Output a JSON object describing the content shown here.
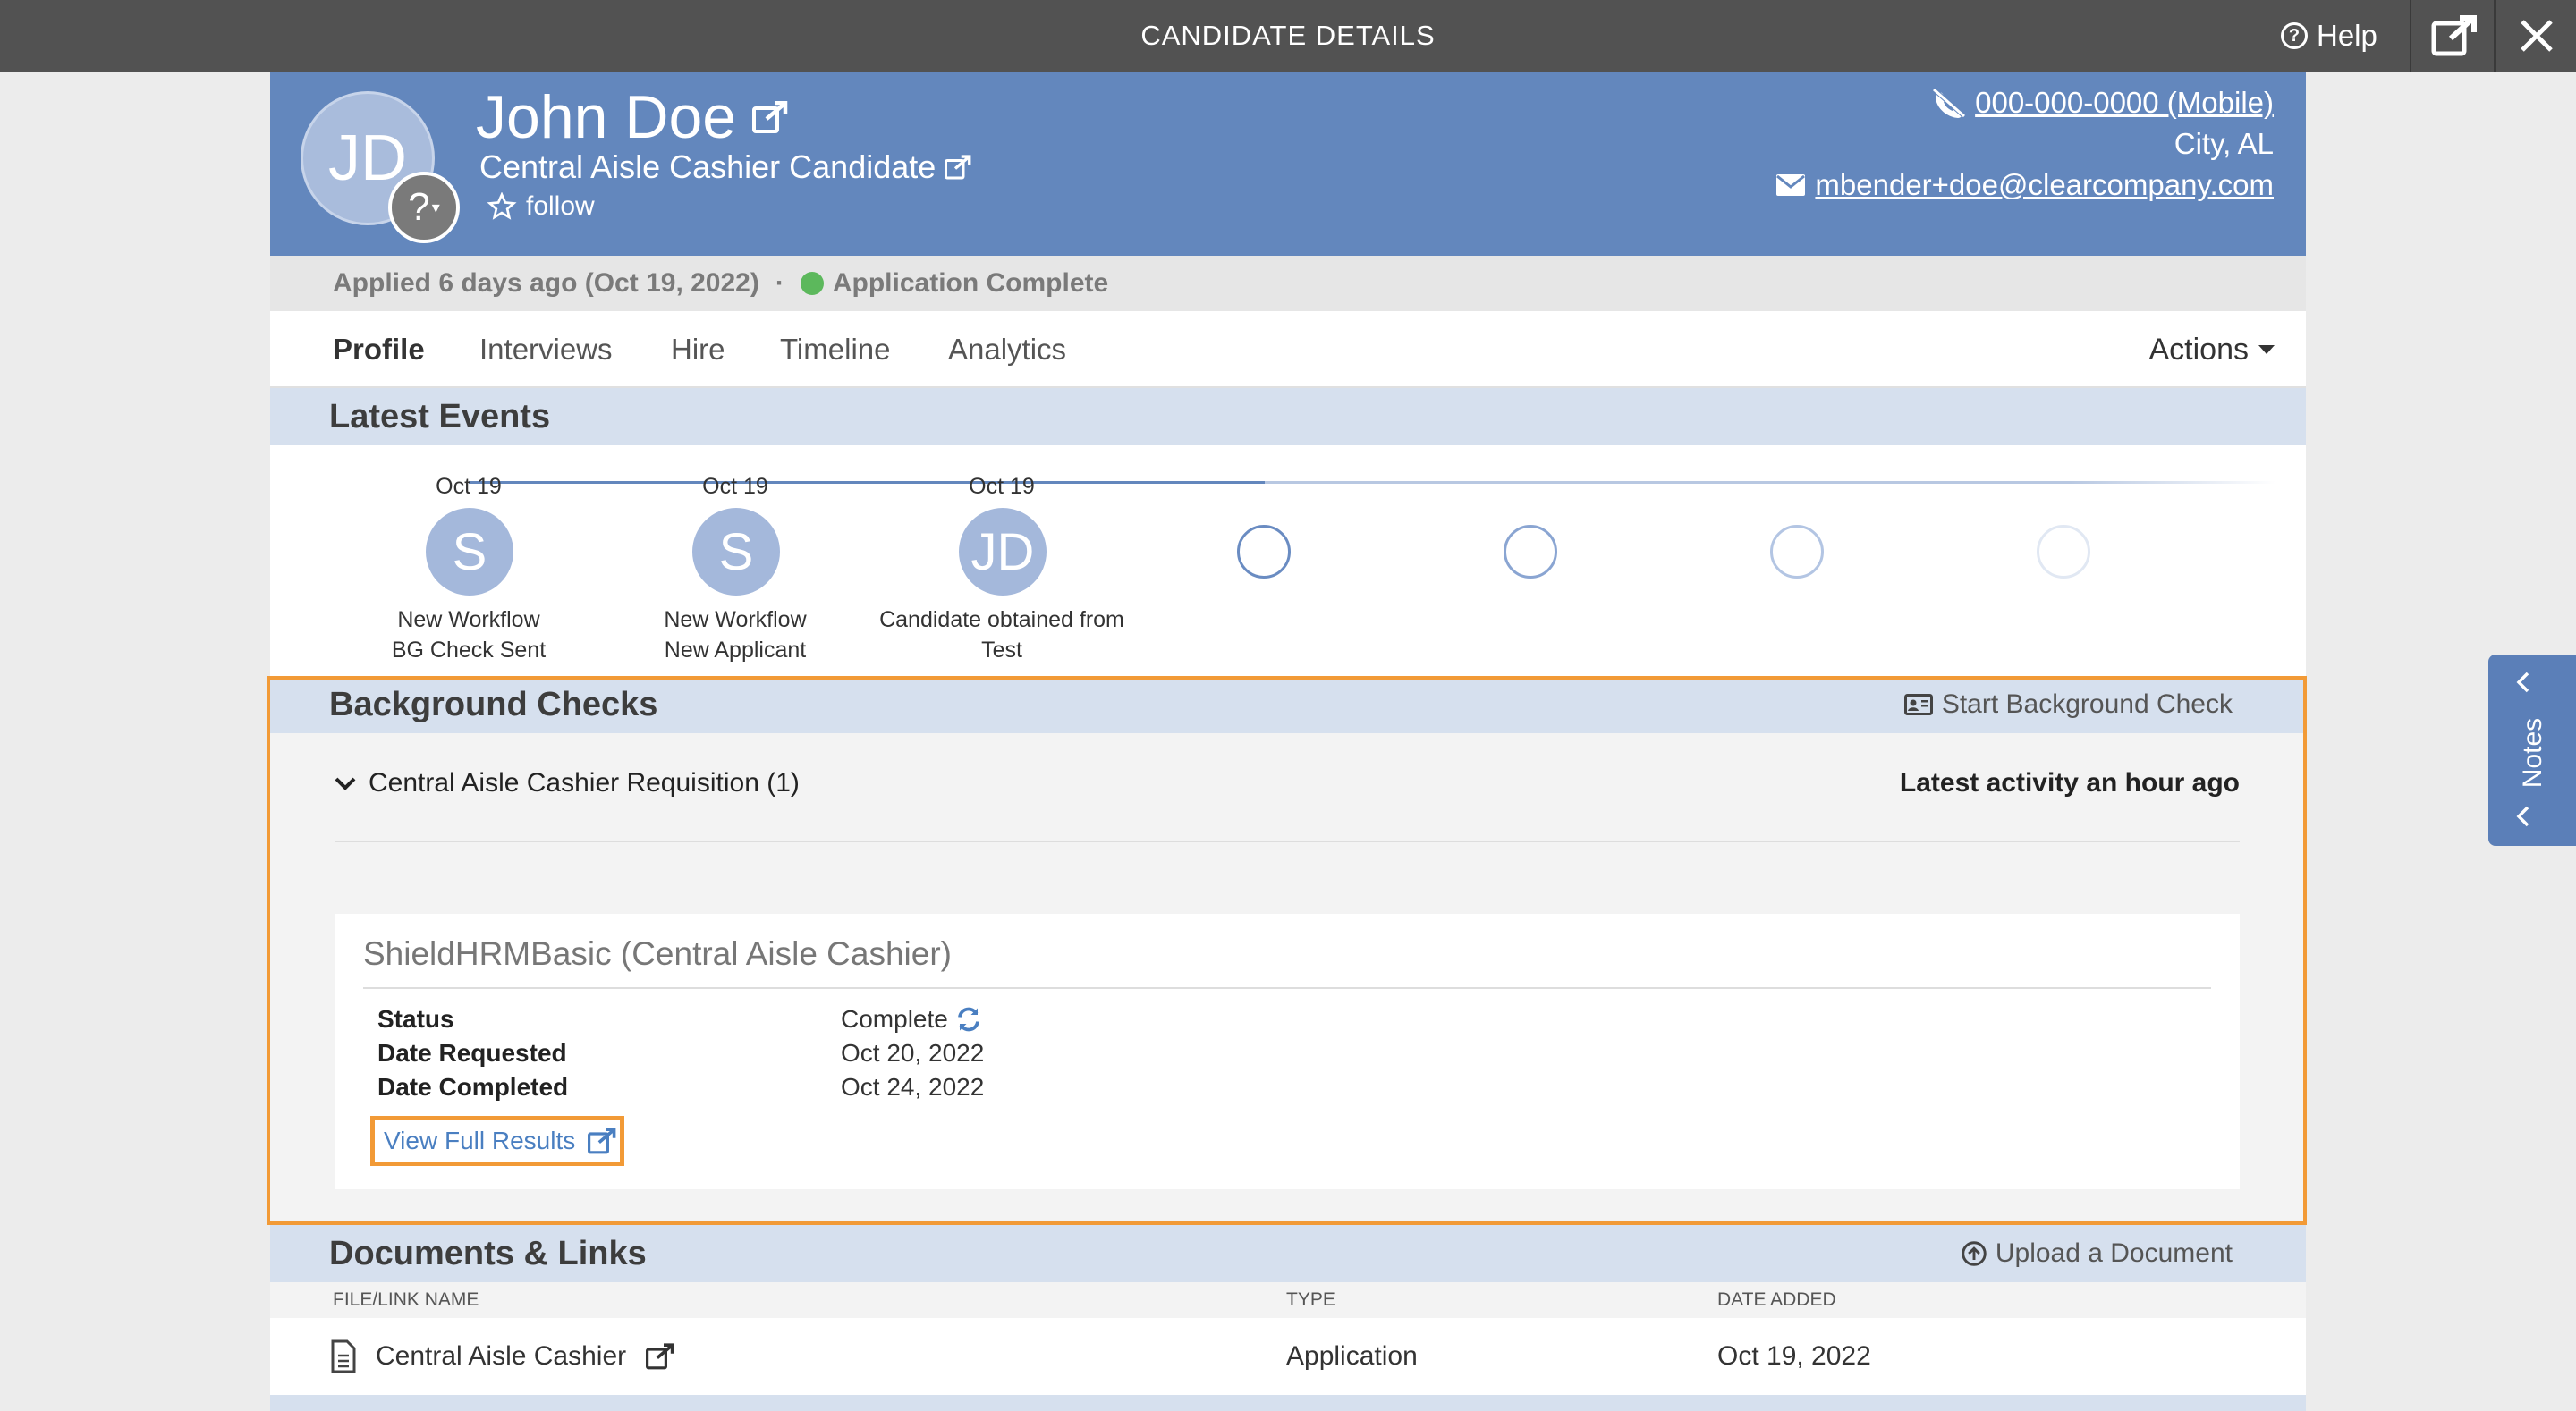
{
  "topbar": {
    "title": "CANDIDATE DETAILS",
    "help_label": "Help"
  },
  "candidate": {
    "initials": "JD",
    "name": "John Doe",
    "title": "Central Aisle Cashier Candidate",
    "follow_label": "follow",
    "phone": "000-000-0000 (Mobile)",
    "location": "City, AL",
    "email": "mbender+doe@clearcompany.com"
  },
  "application": {
    "applied": "Applied 6 days ago (Oct 19, 2022)",
    "separator": "·",
    "status": "Application Complete",
    "status_color": "#5cb85c"
  },
  "tabs": [
    "Profile",
    "Interviews",
    "Hire",
    "Timeline",
    "Analytics"
  ],
  "actions_label": "Actions",
  "latest_events": {
    "heading": "Latest Events",
    "events": [
      {
        "date": "Oct 19",
        "initials": "S",
        "line1": "New Workflow",
        "line2": "BG Check Sent"
      },
      {
        "date": "Oct 19",
        "initials": "S",
        "line1": "New Workflow",
        "line2": "New Applicant"
      },
      {
        "date": "Oct 19",
        "initials": "JD",
        "line1": "Candidate obtained from",
        "line2": "Test"
      }
    ]
  },
  "background_checks": {
    "heading": "Background Checks",
    "start_label": "Start Background Check",
    "requisition": "Central Aisle Cashier Requisition (1)",
    "latest_activity": "Latest activity an hour ago",
    "check": {
      "title": "ShieldHRMBasic (Central Aisle Cashier)",
      "status_key": "Status",
      "status_val": "Complete",
      "requested_key": "Date Requested",
      "requested_val": "Oct 20, 2022",
      "completed_key": "Date Completed",
      "completed_val": "Oct 24, 2022",
      "view_label": "View Full Results"
    }
  },
  "documents": {
    "heading": "Documents & Links",
    "upload_label": "Upload a Document",
    "columns": [
      "FILE/LINK NAME",
      "TYPE",
      "DATE ADDED"
    ],
    "rows": [
      {
        "name": "Central Aisle Cashier",
        "type": "Application",
        "date": "Oct 19, 2022"
      }
    ]
  },
  "notes_label": "Notes",
  "colors": {
    "header_blue": "#6387bd",
    "highlight_orange": "#f29a36",
    "section_blue": "#d6e0ee"
  }
}
